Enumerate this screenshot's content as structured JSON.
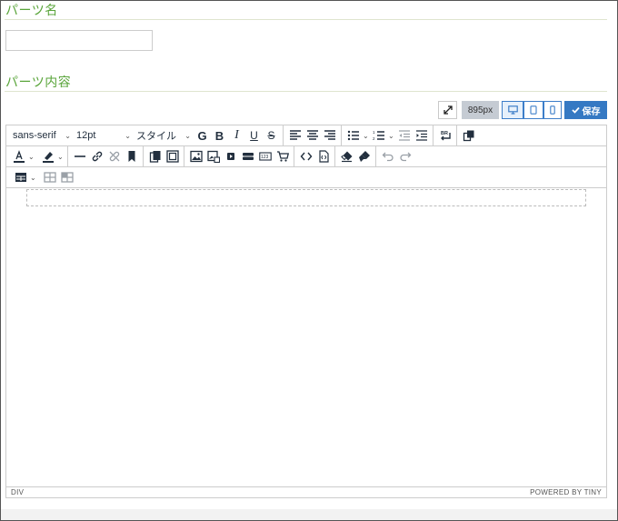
{
  "parts_name": {
    "heading": "パーツ名",
    "input_value": "",
    "input_placeholder": ""
  },
  "parts_content": {
    "heading": "パーツ内容"
  },
  "controls": {
    "width_display": "895px",
    "save_label": "保存",
    "active_device": "desktop"
  },
  "toolbar": {
    "font_family": "sans-serif",
    "font_size": "12pt",
    "style": "スタイル",
    "g_label": "G",
    "bold_label": "B",
    "italic_label": "I",
    "underline_label": "U",
    "strike_label": "S",
    "br_label": "BR"
  },
  "statusbar": {
    "path": "DIV",
    "branding": "POWERED BY TINY"
  },
  "colors": {
    "heading_green": "#5aa53b",
    "save_blue": "#3579c3",
    "text_color_underline": "#222f3e"
  }
}
